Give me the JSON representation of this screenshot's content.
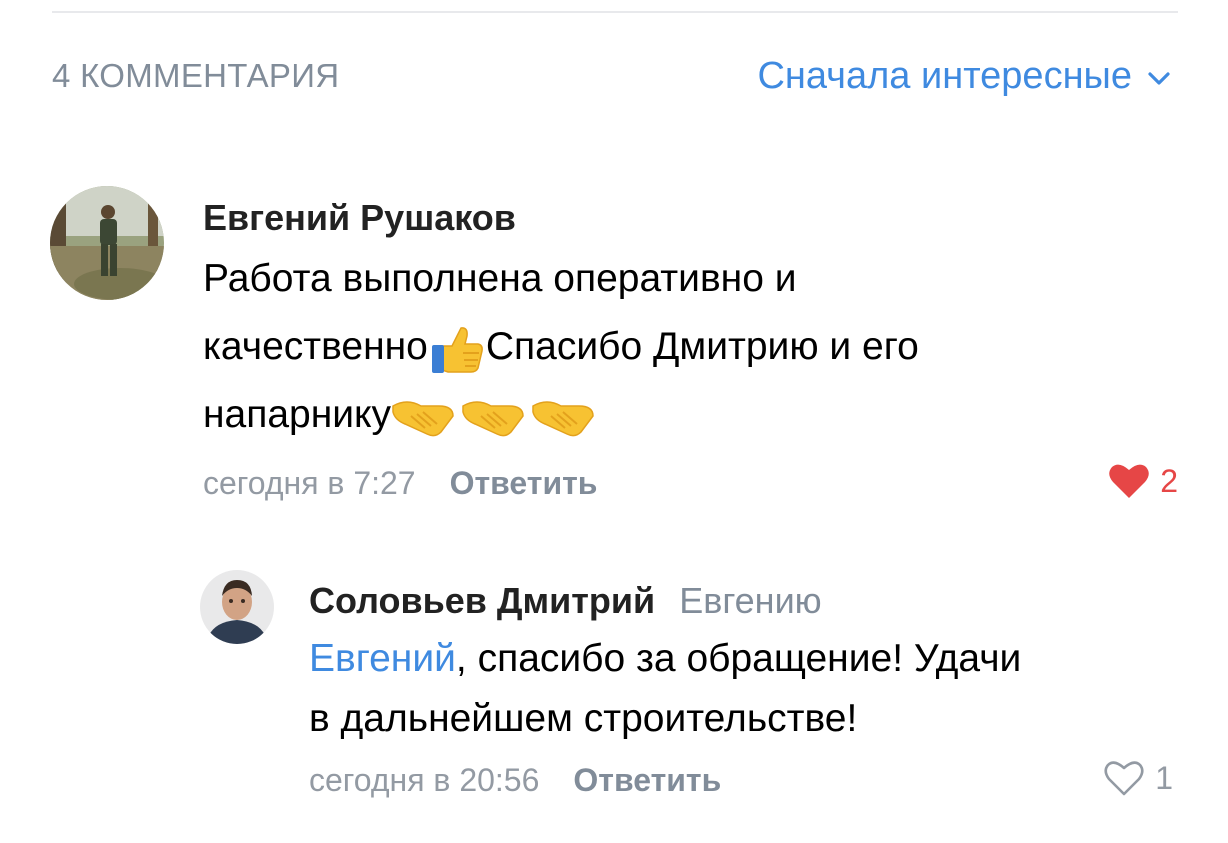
{
  "comments_header": {
    "count_label": "4 КОММЕНТАРИЯ",
    "sort_label": "Сначала интересные",
    "sort_icon": "chevron-down-icon"
  },
  "colors": {
    "accent": "#3f8ae0",
    "secondary_text": "#818c99",
    "like_active": "#e64646"
  },
  "comments": [
    {
      "author": "Евгений Рушаков",
      "text_lines": [
        "Работа выполнена оперативно и",
        "качественно",
        "Спасибо Дмитрию и его",
        "напарнику"
      ],
      "emojis": [
        "thumbs-up",
        "handshake",
        "handshake",
        "handshake"
      ],
      "time": "сегодня в 7:27",
      "reply_label": "Ответить",
      "likes": "2",
      "liked": true
    },
    {
      "author": "Соловьев Дмитрий",
      "reply_to": "Евгению",
      "mention": "Евгений",
      "text_lines": [
        ", спасибо за обращение! Удачи",
        "в дальнейшем строительстве!"
      ],
      "time": "сегодня в 20:56",
      "reply_label": "Ответить",
      "likes": "1",
      "liked": false
    }
  ]
}
